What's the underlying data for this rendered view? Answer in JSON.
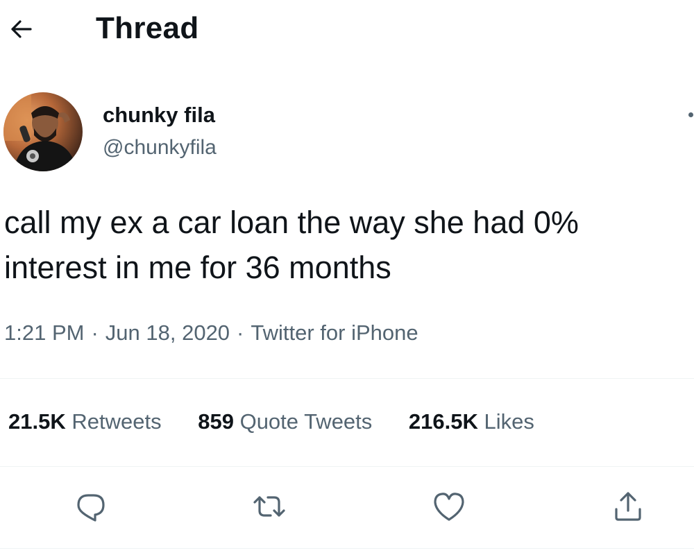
{
  "header": {
    "title": "Thread",
    "back_icon": "arrow-left-icon"
  },
  "author": {
    "display_name": "chunky fila",
    "handle": "@chunkyfila",
    "more_icon": "more-options-icon"
  },
  "tweet": {
    "text_line1": "call my ex a car loan the way she had 0%",
    "text_line2": "interest in me for 36 months",
    "time": "1:21 PM",
    "date": "Jun 18, 2020",
    "source": "Twitter for iPhone",
    "separator": "·"
  },
  "stats": {
    "retweets": {
      "count": "21.5K",
      "label": "Retweets"
    },
    "quote_tweets": {
      "count": "859",
      "label": "Quote Tweets"
    },
    "likes": {
      "count": "216.5K",
      "label": "Likes"
    }
  },
  "actions": [
    {
      "icon": "reply-icon"
    },
    {
      "icon": "retweet-icon"
    },
    {
      "icon": "like-heart-icon"
    },
    {
      "icon": "share-icon"
    }
  ],
  "colors": {
    "text_primary": "#0f1419",
    "text_secondary": "#536471",
    "divider": "#eff3f4",
    "background": "#ffffff"
  }
}
